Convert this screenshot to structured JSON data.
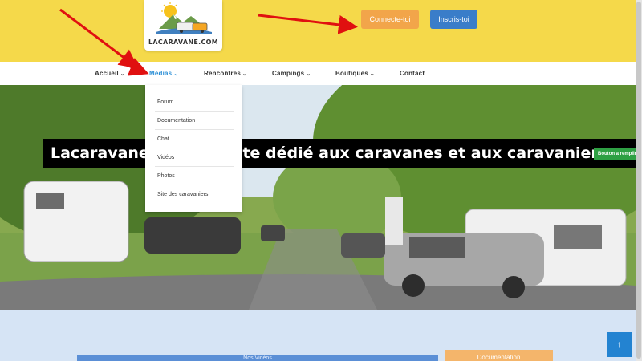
{
  "header": {
    "logo_text": "LACARAVANE.COM",
    "buttons": {
      "connect": "Connecte-toi",
      "signup": "Inscris-toi"
    }
  },
  "nav": {
    "items": [
      {
        "label": "Accueil",
        "has_dropdown": true
      },
      {
        "label": "Médias",
        "has_dropdown": true,
        "active": true
      },
      {
        "label": "Rencontres",
        "has_dropdown": true
      },
      {
        "label": "Campings",
        "has_dropdown": true
      },
      {
        "label": "Boutiques",
        "has_dropdown": true
      },
      {
        "label": "Contact",
        "has_dropdown": false
      }
    ],
    "chevron": "⌄"
  },
  "dropdown": {
    "items": [
      "Forum",
      "Documentation",
      "Chat",
      "Vidéos",
      "Photos",
      "Site des caravaniers"
    ]
  },
  "hero": {
    "title": "Lacaravane.com, un site dédié aux caravanes et aux caravaniers",
    "badge": "Bouton a remplir"
  },
  "lower": {
    "card_blue": "Nos Vidéos",
    "card_orange": "Documentation",
    "to_top": "↑"
  },
  "colors": {
    "header_bg": "#f5d94a",
    "connect_btn": "#f2a54a",
    "signup_btn": "#3a7dc9",
    "active_nav": "#2b8fd6",
    "annotation_arrow": "#e01010"
  }
}
